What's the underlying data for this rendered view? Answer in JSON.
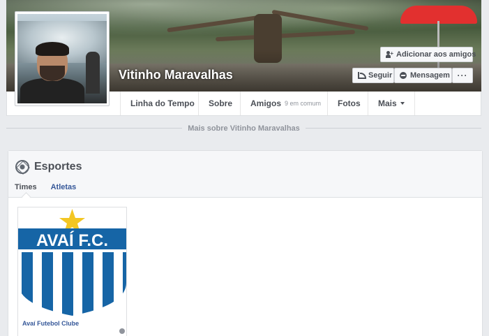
{
  "profile": {
    "name": "Vitinho Maravalhas"
  },
  "cover_actions": {
    "add_friend_label": "Adicionar aos amigos",
    "follow_label": "Seguir",
    "message_label": "Mensagem",
    "more_label": "···"
  },
  "nav": {
    "timeline": "Linha do Tempo",
    "about": "Sobre",
    "friends": "Amigos",
    "friends_sub": "9 em comum",
    "photos": "Fotos",
    "more": "Mais"
  },
  "more_about": "Mais sobre Vitinho Maravalhas",
  "sports": {
    "title": "Esportes",
    "tabs": [
      "Times",
      "Atletas"
    ],
    "team": {
      "crest_text": "AVAÍ F.C.",
      "name": "Avaí Futebol Clube"
    }
  },
  "colors": {
    "accent": "#365899",
    "crest_blue": "#1665a6",
    "star": "#f3c623"
  }
}
